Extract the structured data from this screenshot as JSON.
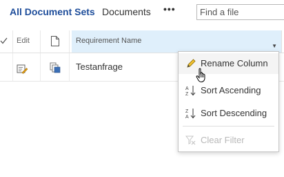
{
  "views": {
    "active_tab": "All Document Sets",
    "tab_documents": "Documents",
    "more": "•••"
  },
  "search": {
    "placeholder": "Find a file"
  },
  "columns": {
    "edit": "Edit",
    "requirement_name": "Requirement Name"
  },
  "rows": [
    {
      "requirement_name": "Testanfrage"
    }
  ],
  "column_menu": {
    "rename": "Rename Column",
    "sort_asc": "Sort Ascending",
    "sort_desc": "Sort Descending",
    "clear_filter": "Clear Filter"
  },
  "icons": {
    "select_all": "checkmark-icon",
    "document_type": "document-icon",
    "edit_row": "edit-properties-icon",
    "row_type": "document-set-icon",
    "rename": "pencil-icon",
    "sort_asc": "sort-a-z-icon",
    "sort_desc": "sort-z-a-icon",
    "clear_filter": "clear-filter-icon",
    "cursor": "hand-pointer-icon"
  },
  "colors": {
    "accent": "#1f4e9b",
    "header_highlight": "#dfeffb",
    "disabled_text": "#b8b8b8"
  }
}
